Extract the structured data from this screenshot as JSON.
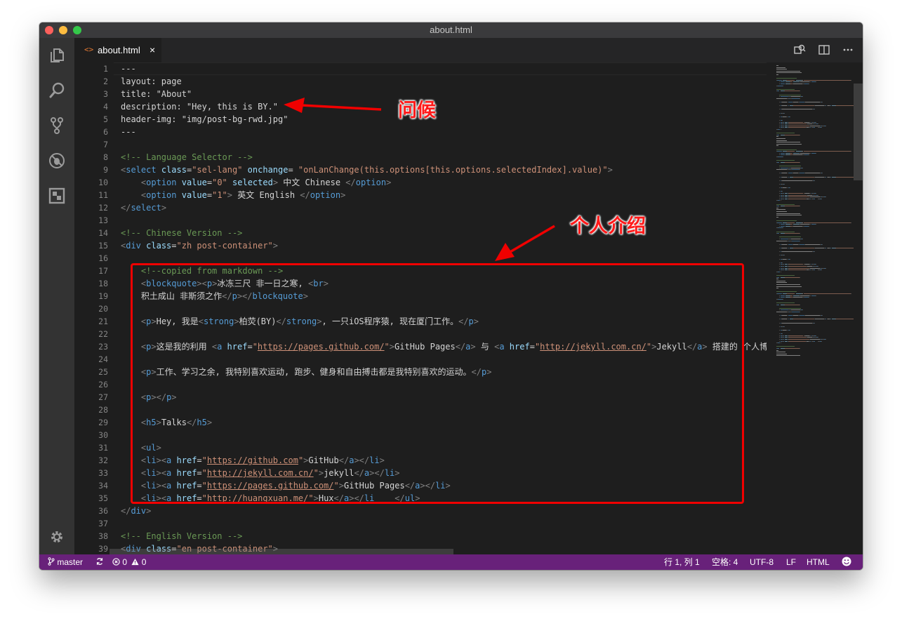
{
  "window": {
    "title": "about.html"
  },
  "tab": {
    "icon": "<>",
    "label": "about.html",
    "close": "×"
  },
  "activity_icons": [
    "explorer-icon",
    "search-icon",
    "source-control-icon",
    "debug-icon",
    "extensions-icon",
    "gear-icon"
  ],
  "line_numbers": [
    "1",
    "2",
    "3",
    "4",
    "5",
    "6",
    "7",
    "8",
    "9",
    "10",
    "11",
    "12",
    "13",
    "14",
    "15",
    "16",
    "17",
    "18",
    "19",
    "20",
    "21",
    "22",
    "23",
    "24",
    "25",
    "26",
    "27",
    "28",
    "29",
    "30",
    "31",
    "32",
    "33",
    "34",
    "35",
    "36",
    "37",
    "38",
    "39"
  ],
  "code_lines": [
    [
      [
        "t",
        "---"
      ]
    ],
    [
      [
        "t",
        "layout: page"
      ]
    ],
    [
      [
        "t",
        "title: \"About\""
      ]
    ],
    [
      [
        "t",
        "description: \"Hey, this is BY.\""
      ]
    ],
    [
      [
        "t",
        "header-img: \"img/post-bg-rwd.jpg\""
      ]
    ],
    [
      [
        "t",
        "---"
      ]
    ],
    [],
    [
      [
        "c",
        "<!-- Language Selector -->"
      ]
    ],
    [
      [
        "p",
        "<"
      ],
      [
        "g",
        "select"
      ],
      [
        "t",
        " "
      ],
      [
        "a",
        "class"
      ],
      [
        "t",
        "="
      ],
      [
        "s",
        "\"sel-lang\""
      ],
      [
        "t",
        " "
      ],
      [
        "a",
        "onchange"
      ],
      [
        "t",
        "= "
      ],
      [
        "s",
        "\"onLanChange(this.options[this.options.selectedIndex].value)\""
      ],
      [
        "p",
        ">"
      ]
    ],
    [
      [
        "t",
        "    "
      ],
      [
        "p",
        "<"
      ],
      [
        "g",
        "option"
      ],
      [
        "t",
        " "
      ],
      [
        "a",
        "value"
      ],
      [
        "t",
        "="
      ],
      [
        "s",
        "\"0\""
      ],
      [
        "t",
        " "
      ],
      [
        "a",
        "selected"
      ],
      [
        "p",
        ">"
      ],
      [
        "t",
        " 中文 Chinese "
      ],
      [
        "p",
        "</"
      ],
      [
        "g",
        "option"
      ],
      [
        "p",
        ">"
      ]
    ],
    [
      [
        "t",
        "    "
      ],
      [
        "p",
        "<"
      ],
      [
        "g",
        "option"
      ],
      [
        "t",
        " "
      ],
      [
        "a",
        "value"
      ],
      [
        "t",
        "="
      ],
      [
        "s",
        "\"1\""
      ],
      [
        "p",
        ">"
      ],
      [
        "t",
        " 英文 English "
      ],
      [
        "p",
        "</"
      ],
      [
        "g",
        "option"
      ],
      [
        "p",
        ">"
      ]
    ],
    [
      [
        "p",
        "</"
      ],
      [
        "g",
        "select"
      ],
      [
        "p",
        ">"
      ]
    ],
    [],
    [
      [
        "c",
        "<!-- Chinese Version -->"
      ]
    ],
    [
      [
        "p",
        "<"
      ],
      [
        "g",
        "div"
      ],
      [
        "t",
        " "
      ],
      [
        "a",
        "class"
      ],
      [
        "t",
        "="
      ],
      [
        "s",
        "\"zh post-container\""
      ],
      [
        "p",
        ">"
      ]
    ],
    [],
    [
      [
        "t",
        "    "
      ],
      [
        "c",
        "<!--copied from markdown -->"
      ]
    ],
    [
      [
        "t",
        "    "
      ],
      [
        "p",
        "<"
      ],
      [
        "g",
        "blockquote"
      ],
      [
        "p",
        "><"
      ],
      [
        "g",
        "p"
      ],
      [
        "p",
        ">"
      ],
      [
        "t",
        "冰冻三尺 非一日之寒, "
      ],
      [
        "p",
        "<"
      ],
      [
        "g",
        "br"
      ],
      [
        "p",
        ">"
      ]
    ],
    [
      [
        "t",
        "    积土成山 非斯须之作"
      ],
      [
        "p",
        "</"
      ],
      [
        "g",
        "p"
      ],
      [
        "p",
        "></"
      ],
      [
        "g",
        "blockquote"
      ],
      [
        "p",
        ">"
      ]
    ],
    [],
    [
      [
        "t",
        "    "
      ],
      [
        "p",
        "<"
      ],
      [
        "g",
        "p"
      ],
      [
        "p",
        ">"
      ],
      [
        "t",
        "Hey, 我是"
      ],
      [
        "p",
        "<"
      ],
      [
        "g",
        "strong"
      ],
      [
        "p",
        ">"
      ],
      [
        "t",
        "柏荧(BY)"
      ],
      [
        "p",
        "</"
      ],
      [
        "g",
        "strong"
      ],
      [
        "p",
        ">"
      ],
      [
        "t",
        ", 一只iOS程序猿, 现在厦门工作。"
      ],
      [
        "p",
        "</"
      ],
      [
        "g",
        "p"
      ],
      [
        "p",
        ">"
      ]
    ],
    [],
    [
      [
        "t",
        "    "
      ],
      [
        "p",
        "<"
      ],
      [
        "g",
        "p"
      ],
      [
        "p",
        ">"
      ],
      [
        "t",
        "这是我的利用 "
      ],
      [
        "p",
        "<"
      ],
      [
        "g",
        "a"
      ],
      [
        "t",
        " "
      ],
      [
        "a",
        "href"
      ],
      [
        "t",
        "="
      ],
      [
        "s",
        "\""
      ],
      [
        "u",
        "https://pages.github.com/"
      ],
      [
        "s",
        "\""
      ],
      [
        "p",
        ">"
      ],
      [
        "t",
        "GitHub Pages"
      ],
      [
        "p",
        "</"
      ],
      [
        "g",
        "a"
      ],
      [
        "p",
        ">"
      ],
      [
        "t",
        " 与 "
      ],
      [
        "p",
        "<"
      ],
      [
        "g",
        "a"
      ],
      [
        "t",
        " "
      ],
      [
        "a",
        "href"
      ],
      [
        "t",
        "="
      ],
      [
        "s",
        "\""
      ],
      [
        "u",
        "http://jekyll.com.cn/"
      ],
      [
        "s",
        "\""
      ],
      [
        "p",
        ">"
      ],
      [
        "t",
        "Jekyll"
      ],
      [
        "p",
        "</"
      ],
      [
        "g",
        "a"
      ],
      [
        "p",
        ">"
      ],
      [
        "t",
        " 搭建的 个人博"
      ]
    ],
    [],
    [
      [
        "t",
        "    "
      ],
      [
        "p",
        "<"
      ],
      [
        "g",
        "p"
      ],
      [
        "p",
        ">"
      ],
      [
        "t",
        "工作、学习之余, 我特别喜欢运动, 跑步、健身和自由搏击都是我特别喜欢的运动。"
      ],
      [
        "p",
        "</"
      ],
      [
        "g",
        "p"
      ],
      [
        "p",
        ">"
      ]
    ],
    [],
    [
      [
        "t",
        "    "
      ],
      [
        "p",
        "<"
      ],
      [
        "g",
        "p"
      ],
      [
        "p",
        "></"
      ],
      [
        "g",
        "p"
      ],
      [
        "p",
        ">"
      ]
    ],
    [],
    [
      [
        "t",
        "    "
      ],
      [
        "p",
        "<"
      ],
      [
        "g",
        "h5"
      ],
      [
        "p",
        ">"
      ],
      [
        "t",
        "Talks"
      ],
      [
        "p",
        "</"
      ],
      [
        "g",
        "h5"
      ],
      [
        "p",
        ">"
      ]
    ],
    [],
    [
      [
        "t",
        "    "
      ],
      [
        "p",
        "<"
      ],
      [
        "g",
        "ul"
      ],
      [
        "p",
        ">"
      ]
    ],
    [
      [
        "t",
        "    "
      ],
      [
        "p",
        "<"
      ],
      [
        "g",
        "li"
      ],
      [
        "p",
        "><"
      ],
      [
        "g",
        "a"
      ],
      [
        "t",
        " "
      ],
      [
        "a",
        "href"
      ],
      [
        "t",
        "="
      ],
      [
        "s",
        "\""
      ],
      [
        "u",
        "https://github.com"
      ],
      [
        "s",
        "\""
      ],
      [
        "p",
        ">"
      ],
      [
        "t",
        "GitHub"
      ],
      [
        "p",
        "</"
      ],
      [
        "g",
        "a"
      ],
      [
        "p",
        "></"
      ],
      [
        "g",
        "li"
      ],
      [
        "p",
        ">"
      ]
    ],
    [
      [
        "t",
        "    "
      ],
      [
        "p",
        "<"
      ],
      [
        "g",
        "li"
      ],
      [
        "p",
        "><"
      ],
      [
        "g",
        "a"
      ],
      [
        "t",
        " "
      ],
      [
        "a",
        "href"
      ],
      [
        "t",
        "="
      ],
      [
        "s",
        "\""
      ],
      [
        "u",
        "http://jekyll.com.cn/"
      ],
      [
        "s",
        "\""
      ],
      [
        "p",
        ">"
      ],
      [
        "t",
        "jekyll"
      ],
      [
        "p",
        "</"
      ],
      [
        "g",
        "a"
      ],
      [
        "p",
        "></"
      ],
      [
        "g",
        "li"
      ],
      [
        "p",
        ">"
      ]
    ],
    [
      [
        "t",
        "    "
      ],
      [
        "p",
        "<"
      ],
      [
        "g",
        "li"
      ],
      [
        "p",
        "><"
      ],
      [
        "g",
        "a"
      ],
      [
        "t",
        " "
      ],
      [
        "a",
        "href"
      ],
      [
        "t",
        "="
      ],
      [
        "s",
        "\""
      ],
      [
        "u",
        "https://pages.github.com/"
      ],
      [
        "s",
        "\""
      ],
      [
        "p",
        ">"
      ],
      [
        "t",
        "GitHub Pages"
      ],
      [
        "p",
        "</"
      ],
      [
        "g",
        "a"
      ],
      [
        "p",
        "></"
      ],
      [
        "g",
        "li"
      ],
      [
        "p",
        ">"
      ]
    ],
    [
      [
        "t",
        "    "
      ],
      [
        "p",
        "<"
      ],
      [
        "g",
        "li"
      ],
      [
        "p",
        "><"
      ],
      [
        "g",
        "a"
      ],
      [
        "t",
        " "
      ],
      [
        "a",
        "href"
      ],
      [
        "t",
        "="
      ],
      [
        "s",
        "\""
      ],
      [
        "u",
        "http://huangxuan.me/"
      ],
      [
        "s",
        "\""
      ],
      [
        "p",
        ">"
      ],
      [
        "t",
        "Hux"
      ],
      [
        "p",
        "</"
      ],
      [
        "g",
        "a"
      ],
      [
        "p",
        "></"
      ],
      [
        "g",
        "li"
      ],
      [
        "t",
        "    "
      ],
      [
        "p",
        "</"
      ],
      [
        "g",
        "ul"
      ],
      [
        "p",
        ">"
      ]
    ],
    [
      [
        "p",
        "</"
      ],
      [
        "g",
        "div"
      ],
      [
        "p",
        ">"
      ]
    ],
    [],
    [
      [
        "c",
        "<!-- English Version -->"
      ]
    ],
    [
      [
        "p",
        "<"
      ],
      [
        "g",
        "div"
      ],
      [
        "t",
        " "
      ],
      [
        "a",
        "class"
      ],
      [
        "t",
        "="
      ],
      [
        "s",
        "\"en post-container\""
      ],
      [
        "p",
        ">"
      ]
    ]
  ],
  "status": {
    "branch": "master",
    "errors": "0",
    "warnings": "0",
    "position": "行 1, 列 1",
    "spaces": "空格: 4",
    "encoding": "UTF-8",
    "eol": "LF",
    "language": "HTML"
  },
  "annotations": {
    "greeting": "问候",
    "intro": "个人介绍"
  },
  "colors": {
    "tag": "#569cd6",
    "attribute": "#9cdcfe",
    "string": "#ce9178",
    "comment": "#6a9955",
    "punct": "#808080",
    "status_bar": "#68217a",
    "annotation": "#ff1a1a"
  }
}
